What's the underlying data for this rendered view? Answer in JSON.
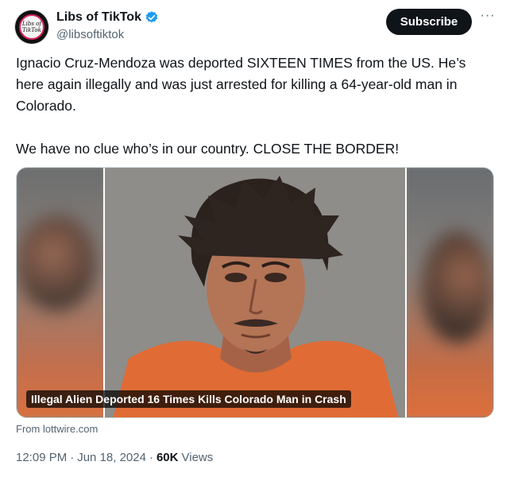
{
  "author": {
    "name": "Libs of TikTok",
    "handle": "@libsoftiktok",
    "avatar_text": "Libs of TikTok",
    "verified_icon": "verified-badge-icon"
  },
  "actions": {
    "subscribe_label": "Subscribe",
    "more_label": "···"
  },
  "post": {
    "paragraph1": "Ignacio Cruz-Mendoza was deported SIXTEEN TIMES from the US. He’s here again illegally and was just arrested for killing a 64-year-old man in Colorado.",
    "paragraph2": "We have no clue who’s in our country. CLOSE THE BORDER!"
  },
  "media": {
    "caption": "Illegal Alien Deported 16 Times Kills Colorado Man in Crash",
    "source": "From lottwire.com"
  },
  "meta": {
    "time": "12:09 PM",
    "sep1": "·",
    "date": "Jun 18, 2024",
    "sep2": "·",
    "views_count": "60K",
    "views_label": "Views"
  },
  "colors": {
    "text": "#0f1419",
    "muted": "#536471",
    "verified": "#1d9bf0",
    "button_bg": "#0f1419"
  }
}
